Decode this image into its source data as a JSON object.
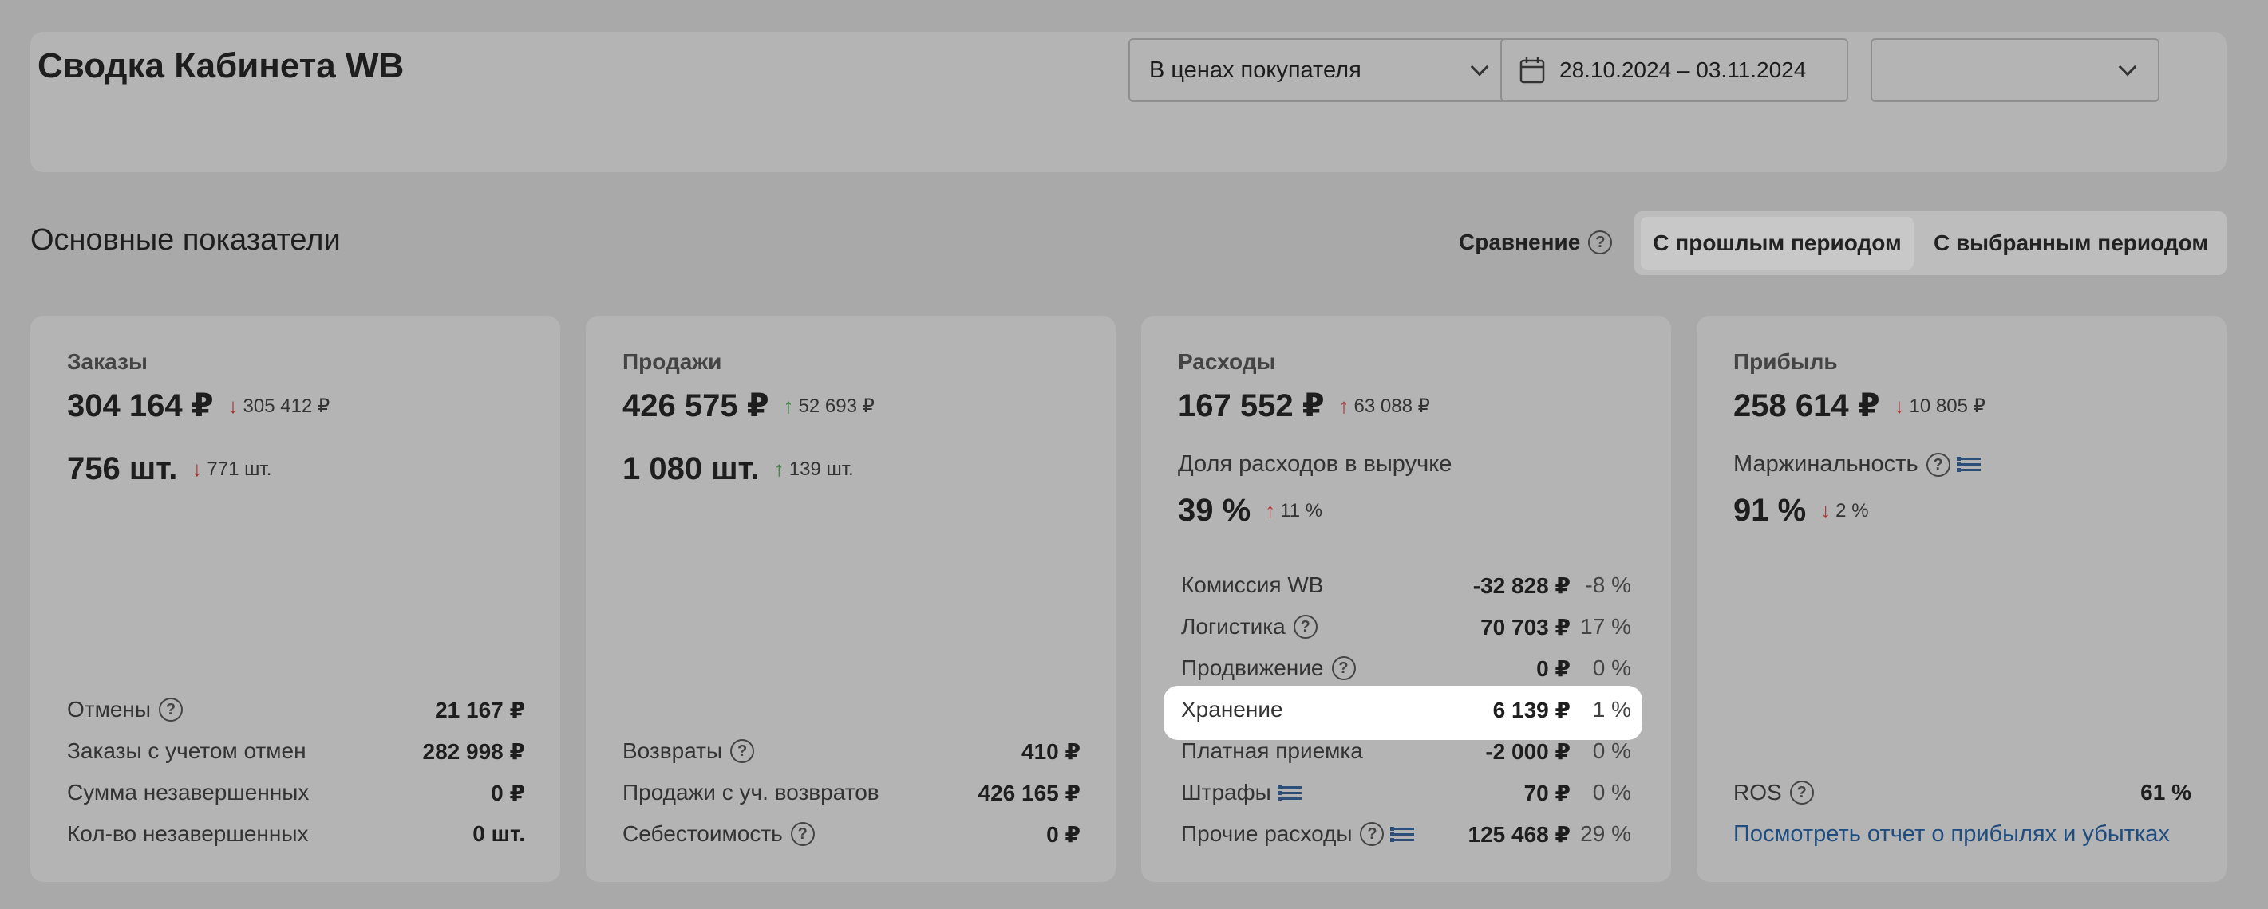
{
  "header": {
    "title": "Сводка Кабинета WB",
    "price_mode": "В ценах покупателя",
    "date_range": "28.10.2024 – 03.11.2024",
    "extra_select": ""
  },
  "section": {
    "title": "Основные показатели",
    "compare_label": "Сравнение",
    "compare_prev": "С прошлым периодом",
    "compare_chosen": "С выбранным периодом"
  },
  "orders": {
    "label": "Заказы",
    "amount": "304 164 ₽",
    "amount_delta": "305 412 ₽",
    "count": "756 шт.",
    "count_delta": "771 шт.",
    "rows": [
      {
        "label": "Отмены",
        "value": "21 167 ₽"
      },
      {
        "label": "Заказы с учетом отмен",
        "value": "282 998 ₽"
      },
      {
        "label": "Сумма незавершенных",
        "value": "0 ₽"
      },
      {
        "label": "Кол-во незавершенных",
        "value": "0 шт."
      }
    ]
  },
  "sales": {
    "label": "Продажи",
    "amount": "426 575 ₽",
    "amount_delta": "52 693 ₽",
    "count": "1 080 шт.",
    "count_delta": "139 шт.",
    "rows": [
      {
        "label": "Возвраты",
        "value": "410 ₽"
      },
      {
        "label": "Продажи с уч. возвратов",
        "value": "426 165 ₽"
      },
      {
        "label": "Себестоимость",
        "value": "0 ₽"
      }
    ]
  },
  "expenses": {
    "label": "Расходы",
    "amount": "167 552 ₽",
    "amount_delta": "63 088 ₽",
    "share_label": "Доля расходов в выручке",
    "share": "39 %",
    "share_delta": "11 %",
    "rows": [
      {
        "label": "Комиссия WB",
        "value": "-32 828 ₽",
        "pct": "-8 %"
      },
      {
        "label": "Логистика",
        "value": "70 703 ₽",
        "pct": "17 %"
      },
      {
        "label": "Продвижение",
        "value": "0 ₽",
        "pct": "0 %"
      },
      {
        "label": "Хранение",
        "value": "6 139 ₽",
        "pct": "1 %"
      },
      {
        "label": "Платная приемка",
        "value": "-2 000 ₽",
        "pct": "0 %"
      },
      {
        "label": "Штрафы",
        "value": "70 ₽",
        "pct": "0 %"
      },
      {
        "label": "Прочие расходы",
        "value": "125 468 ₽",
        "pct": "29 %"
      }
    ]
  },
  "profit": {
    "label": "Прибыль",
    "amount": "258 614 ₽",
    "amount_delta": "10 805 ₽",
    "margin_label": "Маржинальность",
    "margin": "91 %",
    "margin_delta": "2 %",
    "ros_label": "ROS",
    "ros_value": "61 %",
    "report_link": "Посмотреть отчет о прибылях и убытках"
  },
  "colors": {
    "up": "#2e7d32",
    "down": "#a83232",
    "link": "#1f4d80",
    "highlight": "#ffffff"
  },
  "icons": {
    "calendar": "calendar-icon",
    "help": "question-circle-icon",
    "list": "list-icon",
    "dropdown": "chevron-down-icon",
    "arrow_up": "arrow-up-icon",
    "arrow_down": "arrow-down-icon"
  }
}
